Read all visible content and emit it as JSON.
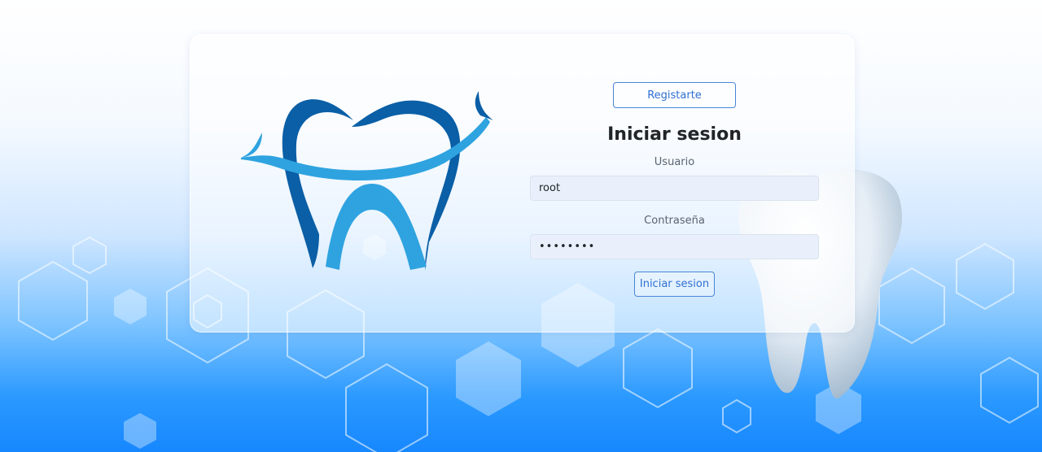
{
  "brand": {
    "logo_icon": "tooth-smile-logo-icon",
    "colors": {
      "dark_blue": "#0a5fa6",
      "light_blue": "#2fa3e0",
      "accent": "#2f6fd1"
    }
  },
  "header": {
    "register_label": "Registarte"
  },
  "form": {
    "title": "Iniciar sesion",
    "username_label": "Usuario",
    "username_value": "root",
    "password_label": "Contraseña",
    "password_value": "••••••••",
    "submit_label": "Iniciar sesion"
  },
  "decor": {
    "background_icon": "hexagon-pattern-icon",
    "tooth_image": "3d-tooth-icon"
  }
}
